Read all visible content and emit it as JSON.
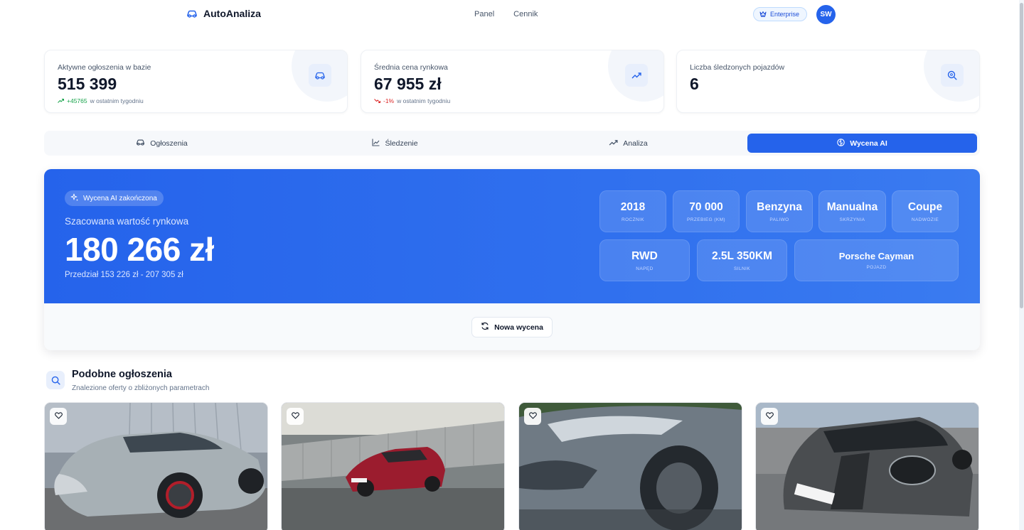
{
  "app": {
    "brand_name": "AutoAnaliza",
    "nav": [
      "Panel",
      "Cennik"
    ],
    "plan_badge": "Enterprise",
    "avatar_initials": "SW"
  },
  "stats": [
    {
      "label": "Aktywne ogłoszenia w bazie",
      "value": "515 399",
      "delta": "+45765",
      "delta_suffix": "w ostatnim tygodniu",
      "trend": "up",
      "icon": "car-icon"
    },
    {
      "label": "Średnia cena rynkowa",
      "value": "67 955 zł",
      "delta": "-1%",
      "delta_suffix": "w ostatnim tygodniu",
      "trend": "down",
      "icon": "trending-up-icon"
    },
    {
      "label": "Liczba śledzonych pojazdów",
      "value": "6",
      "icon": "search-icon"
    }
  ],
  "tabs": [
    {
      "label": "Ogłoszenia",
      "icon": "car-icon",
      "active": false
    },
    {
      "label": "Śledzenie",
      "icon": "line-chart-icon",
      "active": false
    },
    {
      "label": "Analiza",
      "icon": "trending-up-icon",
      "active": false
    },
    {
      "label": "Wycena AI",
      "icon": "brain-icon",
      "active": true
    }
  ],
  "valuation": {
    "status_badge": "Wycena AI zakończona",
    "subtitle": "Szacowana wartość rynkowa",
    "price": "180 266 zł",
    "range": "Przedział 153 226 zł - 207 305 zł",
    "specs": [
      {
        "value": "2018",
        "label": "ROCZNIK"
      },
      {
        "value": "70 000",
        "label": "PRZEBIEG (KM)"
      },
      {
        "value": "Benzyna",
        "label": "PALIWO"
      },
      {
        "value": "Manualna",
        "label": "SKRZYNIA"
      },
      {
        "value": "Coupe",
        "label": "NADWOZIE"
      },
      {
        "value": "RWD",
        "label": "NAPĘD"
      },
      {
        "value": "2.5L 350KM",
        "label": "SILNIK"
      },
      {
        "value": "Porsche Cayman",
        "label": "POJAZD"
      }
    ],
    "new_button": "Nowa wycena"
  },
  "similar": {
    "title": "Podobne ogłoszenia",
    "subtitle": "Znalezione oferty o zbliżonych parametrach",
    "listings": [
      {
        "photo": "grey-porsche-cayman-front-photo",
        "car_color": "#a7b0b5"
      },
      {
        "photo": "red-porsche-cayman-photo",
        "car_color": "#9b1c2e"
      },
      {
        "photo": "grey-porsche-closeup-photo",
        "car_color": "#6f7a84"
      },
      {
        "photo": "dark-grey-porsche-cayman-photo",
        "car_color": "#4a4d50"
      }
    ]
  },
  "colors": {
    "accent": "#2563eb",
    "trend_up": "#16a34a",
    "trend_down": "#dc2626"
  }
}
